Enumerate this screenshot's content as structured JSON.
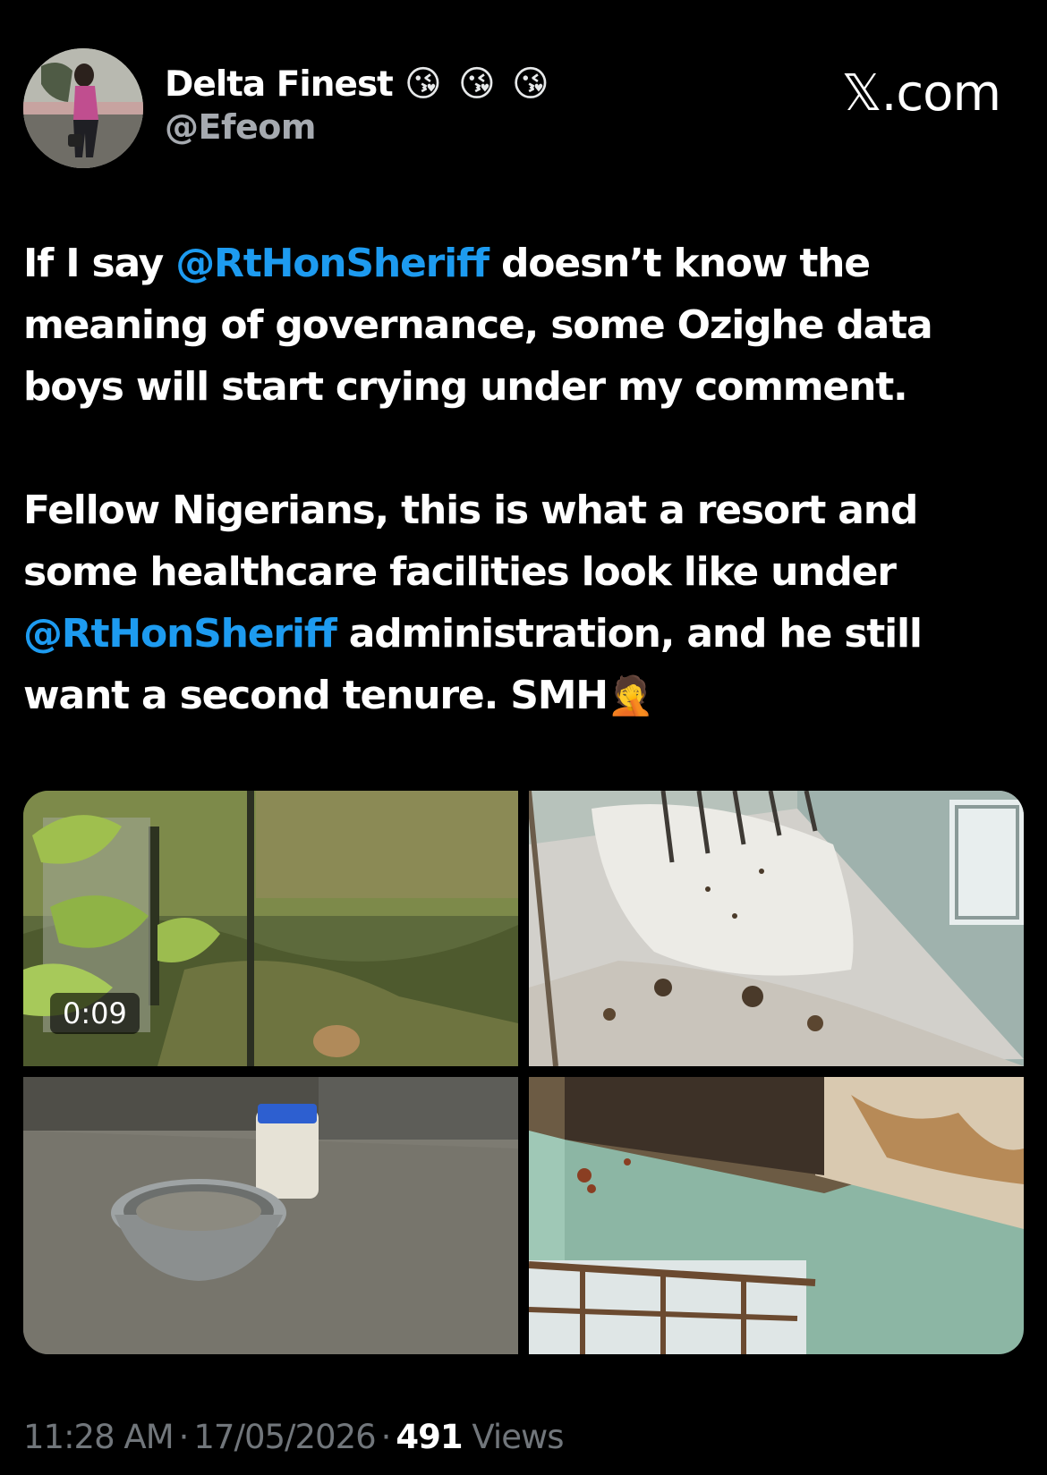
{
  "author": {
    "display_name": "Delta Finest",
    "emojis": [
      "😘",
      "😘",
      "😘"
    ],
    "handle": "@Efeom"
  },
  "brand": "𝕏.com",
  "tweet": {
    "para1": {
      "before": "If I say ",
      "mention": "@RtHonSheriff",
      "after": " doesn’t know the meaning of governance, some Ozighe data boys will start crying under my comment."
    },
    "para2": {
      "before": "Fellow Nigerians, this is what a resort and some healthcare facilities look like under ",
      "mention": "@RtHonSheriff",
      "after": " administration, and he still want a second tenure. SMH",
      "emoji": "🤦"
    }
  },
  "media": {
    "video_duration": "0:09",
    "items": [
      "video-overgrown-bush",
      "photo-stained-bed",
      "photo-metal-bowl",
      "photo-damaged-ceiling"
    ]
  },
  "meta": {
    "time": "11:28 AM",
    "date": "17/05/2026",
    "views_count": "491",
    "views_label": "Views",
    "separator": "·"
  },
  "colors": {
    "background": "#000000",
    "mention": "#1d9bf0",
    "secondary_text": "#71767b"
  }
}
